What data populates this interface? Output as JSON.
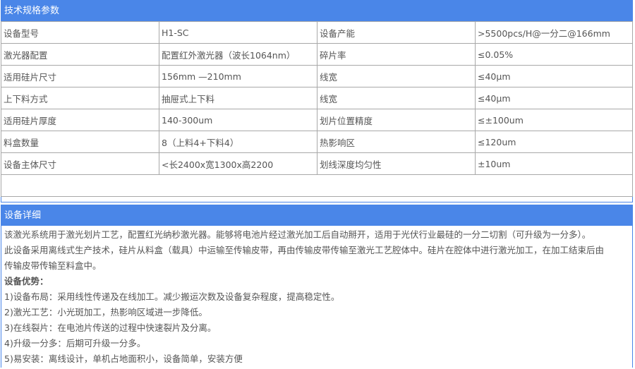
{
  "spec": {
    "title": "技术规格参数",
    "rows": [
      [
        "设备型号",
        "H1-SC",
        "设备产能",
        ">5500pcs/H@一分二@166mm"
      ],
      [
        "激光器配置",
        "配置红外激光器（波长1064nm）",
        "碎片率",
        "≤0.05%"
      ],
      [
        "适用硅片尺寸",
        "156mm —210mm",
        "线宽",
        "≤40μm"
      ],
      [
        "上下料方式",
        "抽屉式上下料",
        "线宽",
        "≤40μm"
      ],
      [
        "适用硅片厚度",
        "140-300um",
        "划片位置精度",
        "≤±100um"
      ],
      [
        "料盒数量",
        "8（上料4+下料4）",
        "热影响区",
        "≤120um"
      ],
      [
        "设备主体尺寸",
        "<长2400x宽1300x高2200",
        "划线深度均匀性",
        "±10um"
      ]
    ]
  },
  "detail": {
    "title": "设备详细",
    "intro_1": "该激光系统用于激光划片工艺，配置红光纳秒激光器。能够将电池片经过激光加工后自动掰开，适用于光伏行业最硅的一分二切割（可升级为一分多）。",
    "intro_2": "此设备采用离线式生产技术，硅片从料盒（载具）中运输至传输皮带，再由传输皮带传输至激光工艺腔体中。硅片在腔体中进行激光加工，在加工结束后由",
    "intro_3": "传输皮带传输至料盒中。",
    "advantages_title": "设备优势：",
    "advantages": [
      "1)设备布局：采用线性传递及在线加工。减少搬运次数及设备复杂程度，提高稳定性。",
      "2)激光工艺：小光斑加工，热影响区域进一步降低。",
      "3)在线裂片：在电池片传送的过程中快速裂片及分离。",
      "4)升级一分多：后期可升级一分多。",
      "5)易安装：离线设计，单机占地面积小，设备简单，安装方便"
    ]
  },
  "colors": {
    "header_bg": "#4a86e8",
    "header_text": "#ffffff",
    "body_text": "#555555",
    "grid_line": "#a8a8a8"
  }
}
